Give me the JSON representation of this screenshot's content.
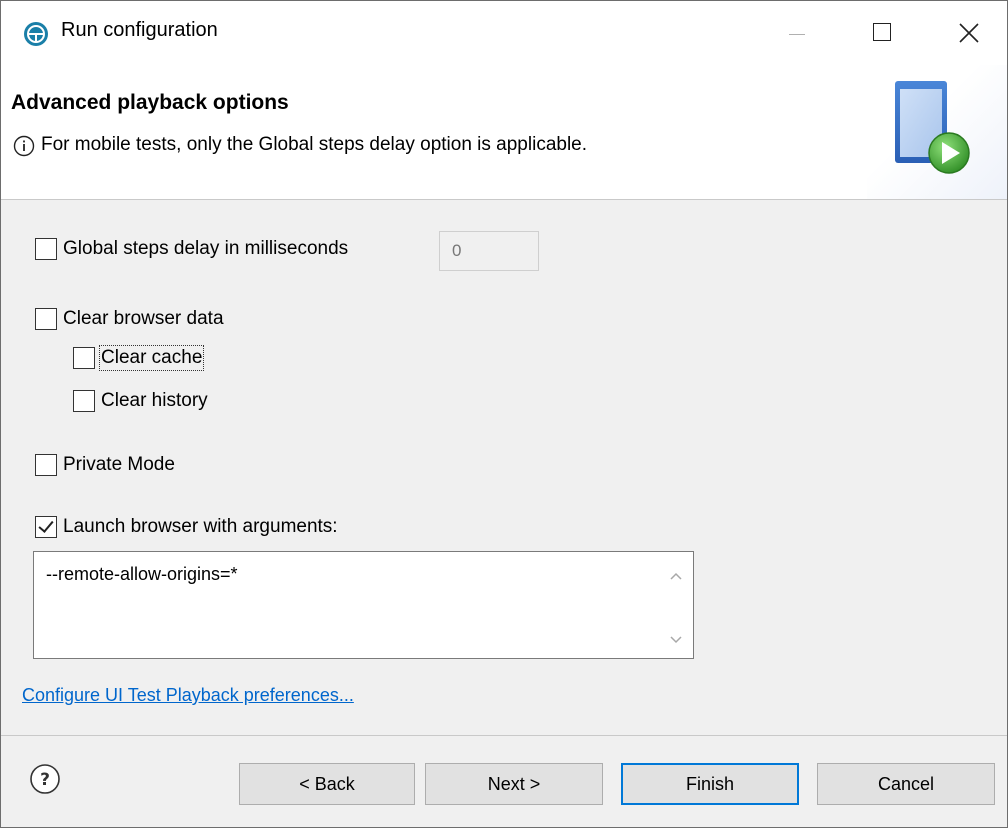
{
  "window": {
    "title": "Run configuration"
  },
  "banner": {
    "title": "Advanced playback options",
    "message": "For mobile tests, only the Global steps delay option is applicable."
  },
  "options": {
    "global_delay": {
      "label": "Global steps delay in milliseconds",
      "checked": false,
      "value": "0"
    },
    "clear_browser_data": {
      "label": "Clear browser data",
      "checked": false
    },
    "clear_cache": {
      "label": "Clear cache",
      "checked": false
    },
    "clear_history": {
      "label": "Clear history",
      "checked": false
    },
    "private_mode": {
      "label": "Private Mode",
      "checked": false
    },
    "launch_args": {
      "label": "Launch browser with arguments:",
      "checked": true,
      "value": "--remote-allow-origins=*"
    }
  },
  "link": {
    "label": "Configure UI Test Playback preferences..."
  },
  "buttons": {
    "back": "< Back",
    "next": "Next >",
    "finish": "Finish",
    "cancel": "Cancel"
  },
  "colors": {
    "link": "#0066cc",
    "focus_border": "#0078d7",
    "app_icon": "#1a7fa8",
    "play_green": "#4caf3a"
  }
}
